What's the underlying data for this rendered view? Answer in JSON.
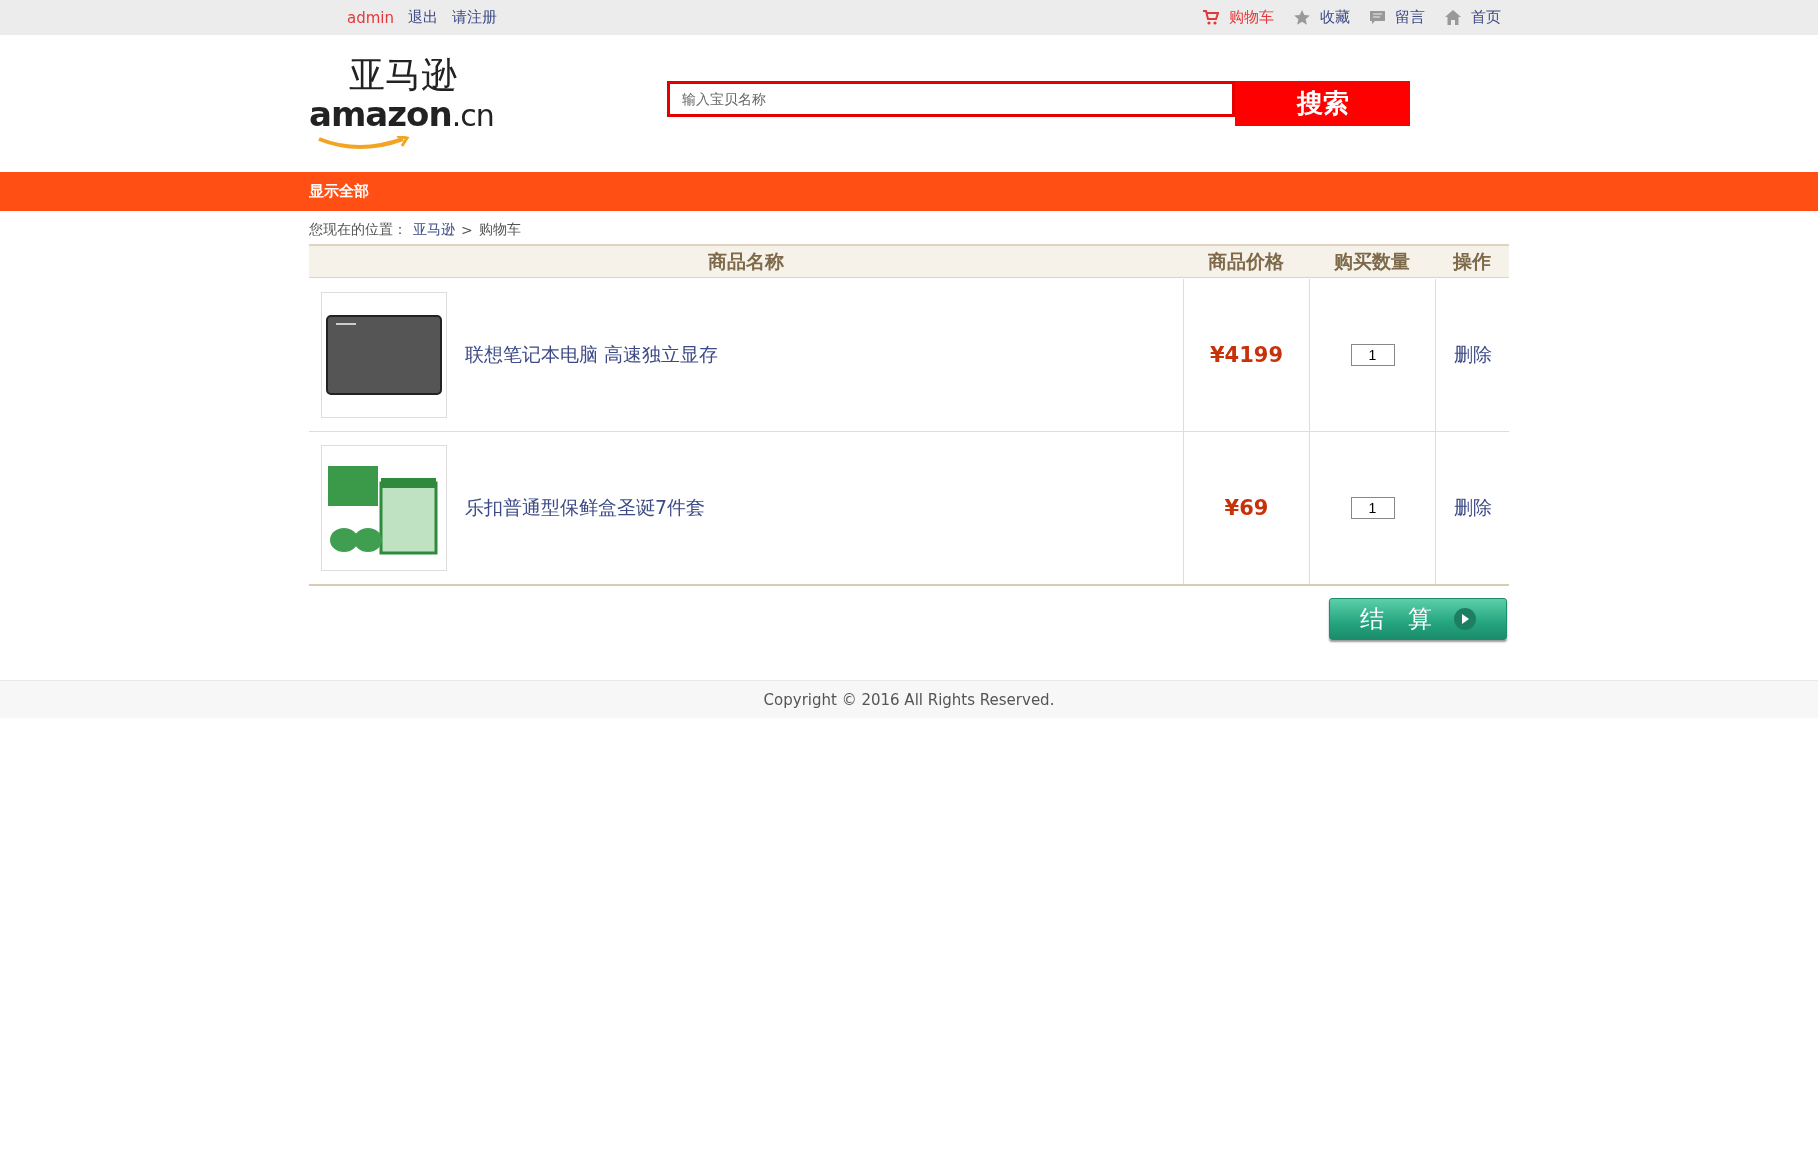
{
  "top_bar": {
    "user": "admin",
    "links_left": [
      "退出",
      "请注册"
    ],
    "links_right": [
      {
        "label": "购物车",
        "selected": true
      },
      {
        "label": "收藏",
        "selected": false
      },
      {
        "label": "留言",
        "selected": false
      },
      {
        "label": "首页",
        "selected": false
      }
    ]
  },
  "logo": {
    "top": "亚马逊",
    "word": "amazon",
    "suffix": ".cn"
  },
  "search": {
    "placeholder": "输入宝贝名称",
    "button": "搜索"
  },
  "nav": {
    "items": [
      "显示全部"
    ]
  },
  "breadcrumb": {
    "prefix": "您现在的位置：",
    "trail": [
      "亚马逊",
      "购物车"
    ],
    "separator": ">"
  },
  "table": {
    "columns": [
      "商品名称",
      "商品价格",
      "购买数量",
      "操作"
    ],
    "rows": [
      {
        "name": "联想笔记本电脑 高速独立显存",
        "price": "¥4199",
        "quantity": "1",
        "action": "删除"
      },
      {
        "name": "乐扣普通型保鲜盒圣诞7件套",
        "price": "¥69",
        "quantity": "1",
        "action": "删除"
      }
    ]
  },
  "checkout": {
    "label": "结　算"
  },
  "footer": {
    "text": "Copyright © 2016 All Rights Reserved."
  }
}
